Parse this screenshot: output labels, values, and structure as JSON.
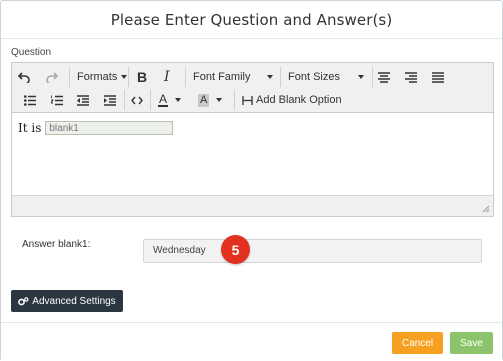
{
  "dialog": {
    "title": "Please Enter Question and Answer(s)"
  },
  "question": {
    "label": "Question",
    "toolbar": {
      "formats_label": "Formats",
      "bold_label": "B",
      "italic_label": "I",
      "font_family_label": "Font Family",
      "font_sizes_label": "Font Sizes",
      "text_color_label": "A",
      "bg_color_label": "A",
      "add_blank_label": "Add Blank Option"
    },
    "content": {
      "text": "It is",
      "blank_value": "blank1"
    }
  },
  "answer": {
    "label": "Answer blank1:",
    "value": "Wednesday"
  },
  "badge": {
    "number": "5",
    "color": "#e3311f"
  },
  "advanced_settings": {
    "label": "Advanced Settings"
  },
  "footer": {
    "cancel_label": "Cancel",
    "save_label": "Save"
  },
  "colors": {
    "cancel": "#f6a021",
    "save": "#8bc46a",
    "advanced": "#2c3641"
  }
}
